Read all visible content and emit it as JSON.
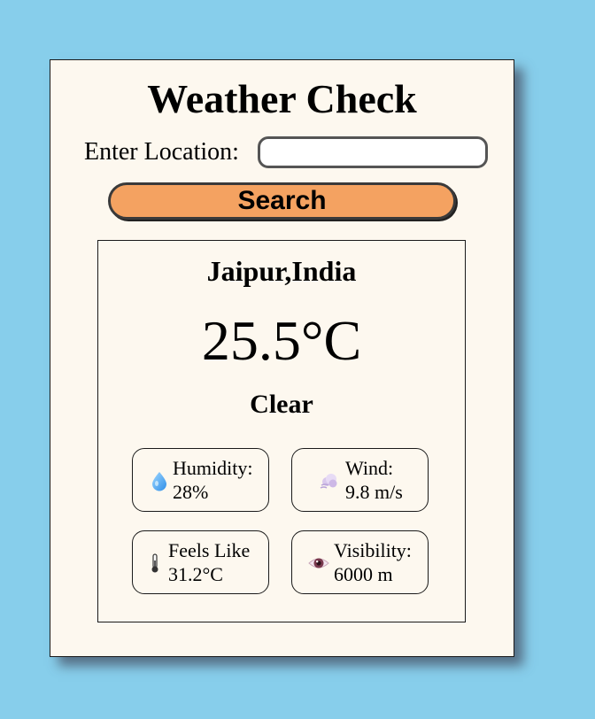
{
  "app": {
    "title": "Weather Check"
  },
  "search": {
    "label": "Enter Location:",
    "value": "",
    "placeholder": "",
    "button_label": "Search"
  },
  "weather": {
    "location": "Jaipur,India",
    "temperature": "25.5°C",
    "condition": "Clear",
    "stats": {
      "humidity": {
        "label": "Humidity:",
        "value": "28%",
        "icon": "water-drop-icon"
      },
      "wind": {
        "label": "Wind:",
        "value": "9.8 m/s",
        "icon": "wind-cloud-icon"
      },
      "feels_like": {
        "label": "Feels Like",
        "value": "31.2°C",
        "icon": "thermometer-icon"
      },
      "visibility": {
        "label": "Visibility:",
        "value": "6000 m",
        "icon": "eye-icon"
      }
    }
  },
  "colors": {
    "background": "#87ceeb",
    "card": "#fdf8ef",
    "button": "#f4a261"
  }
}
